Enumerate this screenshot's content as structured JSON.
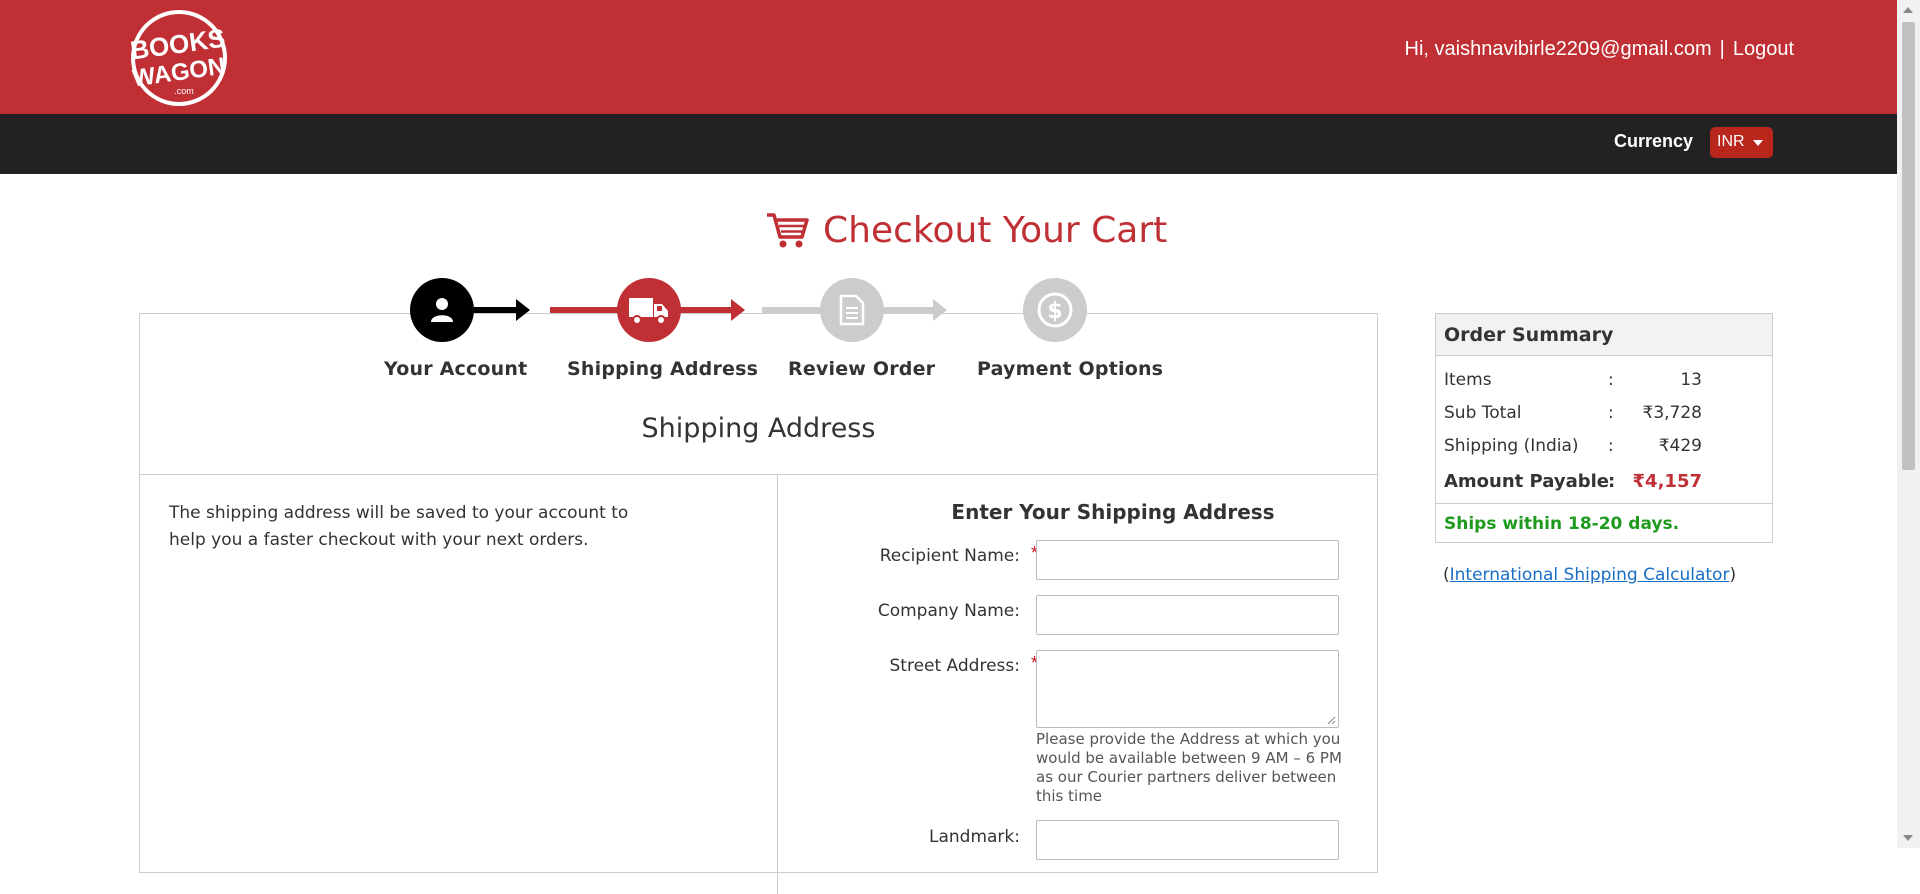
{
  "header": {
    "logo_top": "BOOKS",
    "logo_bottom": "WAGON",
    "logo_domain": ".com",
    "greeting": "Hi, vaishnavibirle2209@gmail.com",
    "separator": "|",
    "logout": "Logout",
    "brand_color": "#bf2f34"
  },
  "currency": {
    "label": "Currency",
    "selected": "INR"
  },
  "checkout": {
    "title": "Checkout Your Cart",
    "icon": "cart-icon"
  },
  "steps": [
    {
      "label": "Your Account",
      "icon": "user-icon",
      "state": "done",
      "color": "#000000"
    },
    {
      "label": "Shipping Address",
      "icon": "truck-icon",
      "state": "active",
      "color": "#bf2f34"
    },
    {
      "label": "Review Order",
      "icon": "document-icon",
      "state": "pending",
      "color": "#cccccc"
    },
    {
      "label": "Payment Options",
      "icon": "dollar-icon",
      "state": "pending",
      "color": "#cccccc"
    }
  ],
  "section_title": "Shipping Address",
  "note": "The shipping address will be saved to your account to help you a faster checkout with your next orders.",
  "form": {
    "title": "Enter Your Shipping Address",
    "fields": [
      {
        "label": "Recipient Name:",
        "required": true,
        "value": ""
      },
      {
        "label": "Company Name:",
        "required": false,
        "value": ""
      },
      {
        "label": "Street Address:",
        "required": true,
        "value": ""
      },
      {
        "label": "Landmark:",
        "required": false,
        "value": ""
      }
    ],
    "required_mark": "*",
    "street_hint": "Please provide the Address at which you would be available between 9 AM – 6 PM as our Courier partners deliver between this time"
  },
  "summary": {
    "title": "Order Summary",
    "colon": ":",
    "rows": [
      {
        "label": "Items",
        "value": "13"
      },
      {
        "label": "Sub Total",
        "value": "₹3,728"
      },
      {
        "label": "Shipping (India)",
        "value": "₹429"
      }
    ],
    "payable": {
      "label": "Amount Payable",
      "value": "₹4,157"
    },
    "ships": "Ships within 18-20 days.",
    "ships_color": "#1e9b1e"
  },
  "calculator": {
    "open_paren": "(",
    "link": "International Shipping Calculator",
    "close_paren": ")"
  }
}
